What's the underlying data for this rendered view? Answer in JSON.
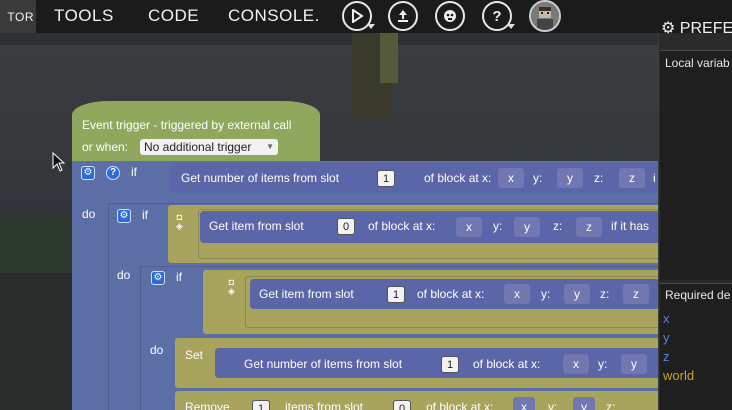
{
  "menu": {
    "partial_tab": "TOR",
    "tools": "TOOLS",
    "code": "CODE",
    "console": "CONSOLE."
  },
  "toolbar_icons": [
    "play-icon",
    "export-icon",
    "debug-icon",
    "help-icon",
    "user-avatar"
  ],
  "preferences": {
    "label": "PREFE"
  },
  "panels": {
    "local_vars_title": "Local variab",
    "required_deps_title": "Required de",
    "dependencies": [
      {
        "name": "x",
        "color": "#5f7fe0"
      },
      {
        "name": "y",
        "color": "#5f7fe0"
      },
      {
        "name": "z",
        "color": "#5f7fe0"
      },
      {
        "name": "world",
        "color": "#c9a227"
      }
    ]
  },
  "event": {
    "header": "Event trigger - triggered by external call",
    "or_when": "or when:",
    "trigger_value": "No additional trigger"
  },
  "blocks": {
    "if_kw": "if",
    "do_kw": "do",
    "set_kw": "Set",
    "row1": {
      "text": "Get number of items from slot",
      "slot": "1",
      "of_block": "of block at x:",
      "x": "x",
      "y_lbl": "y:",
      "y": "y",
      "z_lbl": "z:",
      "z": "z",
      "tail": "i"
    },
    "row2": {
      "text": "Get item from slot",
      "slot": "0",
      "of_block": "of block at x:",
      "x": "x",
      "y_lbl": "y:",
      "y": "y",
      "z_lbl": "z:",
      "z": "z",
      "tail": "if it has"
    },
    "row3": {
      "text": "Get item from slot",
      "slot": "1",
      "of_block": "of block at x:",
      "x": "x",
      "y_lbl": "y:",
      "y": "y",
      "z_lbl": "z:",
      "z": "z"
    },
    "row4": {
      "text": "Get number of items from slot",
      "slot": "1",
      "of_block": "of block at x:",
      "x": "x",
      "y_lbl": "y:",
      "y": "y"
    },
    "row5": {
      "remove": "Remove",
      "slot_a": "1",
      "items_from": "items from slot",
      "slot_b": "0",
      "of_block": "of block at x:",
      "x": "x",
      "y_lbl": "y:",
      "y": "y",
      "z_lbl": "z:"
    }
  },
  "colors": {
    "event_green": "#90a85e",
    "logic_blue": "#5c6ea6",
    "item_blue": "#5a66a8",
    "olive": "#a8a45e"
  }
}
